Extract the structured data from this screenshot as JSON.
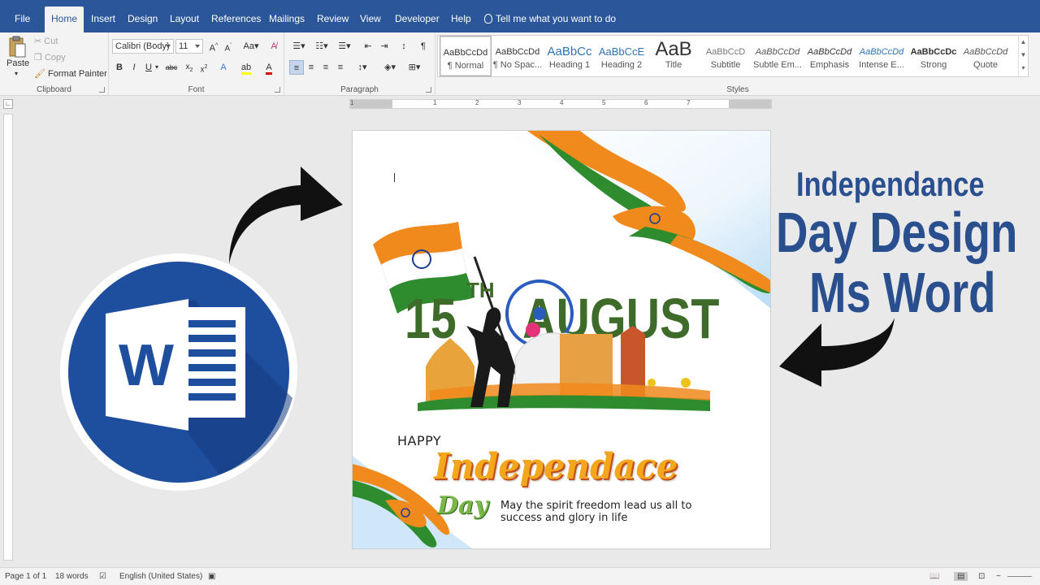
{
  "tabs": [
    "File",
    "Home",
    "Insert",
    "Design",
    "Layout",
    "References",
    "Mailings",
    "Review",
    "View",
    "Developer",
    "Help"
  ],
  "active_tab": "Home",
  "tell_me": "Tell me what you want to do",
  "clipboard": {
    "paste": "Paste",
    "cut": "Cut",
    "copy": "Copy",
    "format_painter": "Format Painter",
    "label": "Clipboard"
  },
  "font": {
    "name": "Calibri (Body)",
    "size": "11",
    "label": "Font"
  },
  "paragraph": {
    "label": "Paragraph"
  },
  "styles": {
    "label": "Styles",
    "items": [
      {
        "sample": "AaBbCcDd",
        "name": "¶ Normal"
      },
      {
        "sample": "AaBbCcDd",
        "name": "¶ No Spac..."
      },
      {
        "sample": "AaBbCc",
        "name": "Heading 1"
      },
      {
        "sample": "AaBbCcE",
        "name": "Heading 2"
      },
      {
        "sample": "AaB",
        "name": "Title"
      },
      {
        "sample": "AaBbCcD",
        "name": "Subtitle"
      },
      {
        "sample": "AaBbCcDd",
        "name": "Subtle Em..."
      },
      {
        "sample": "AaBbCcDd",
        "name": "Emphasis"
      },
      {
        "sample": "AaBbCcDd",
        "name": "Intense E..."
      },
      {
        "sample": "AaBbCcDc",
        "name": "Strong"
      },
      {
        "sample": "AaBbCcDd",
        "name": "Quote"
      }
    ]
  },
  "ruler_numbers": [
    "1",
    "1",
    "2",
    "3",
    "4",
    "5",
    "6",
    "7"
  ],
  "poster": {
    "big_date": "15",
    "superscript": "TH",
    "month": "AUGUST",
    "happy": "HAPPY",
    "independence": "Independace",
    "day": "Day",
    "message_line1": "May the spirit freedom lead us all to",
    "message_line2": "success and glory in life"
  },
  "headline": {
    "line1": "Independance",
    "line2": "Day Design",
    "line3": "Ms Word"
  },
  "logo_letter": "W",
  "status": {
    "page": "Page 1 of 1",
    "words": "18 words",
    "language": "English (United States)"
  },
  "colors": {
    "word_blue": "#2b579a",
    "headline_blue": "#2a4f8f",
    "saffron": "#f08a1c",
    "india_green": "#2e8b2e",
    "ashoka_blue": "#1a3c8f"
  }
}
